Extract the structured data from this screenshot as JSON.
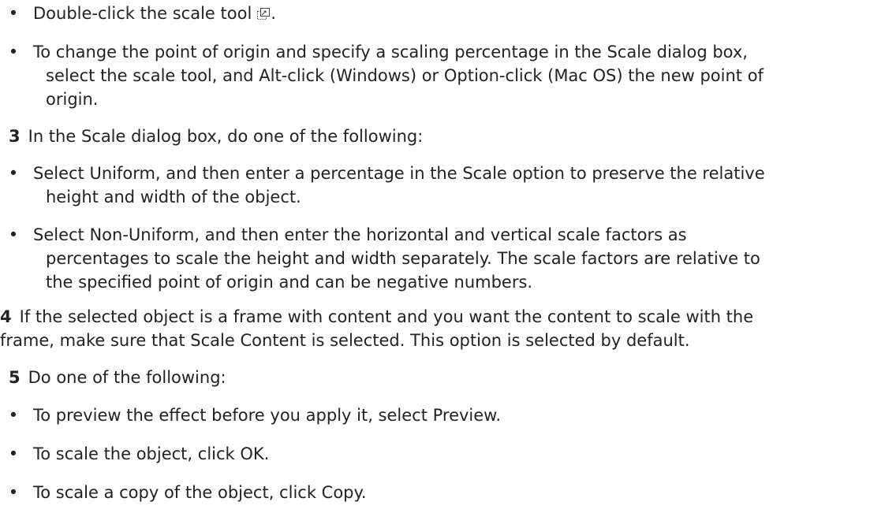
{
  "items": [
    {
      "kind": "bullet",
      "text": "Double-click the scale tool",
      "suffix": ".",
      "icon": "scale-tool-icon"
    },
    {
      "kind": "bullet",
      "lines": [
        "To change the point of origin and specify a scaling percentage in the Scale dialog box,",
        "select the scale tool, and Alt-click (Windows) or Option-click (Mac OS) the new point of",
        "origin."
      ]
    },
    {
      "kind": "step",
      "num": "3",
      "text": "In the Scale dialog box, do one of the following:"
    },
    {
      "kind": "bullet",
      "lines": [
        "Select Uniform, and then enter a percentage in the Scale option to preserve the relative",
        "height and width of the object."
      ]
    },
    {
      "kind": "bullet",
      "lines": [
        "Select Non-Uniform, and then enter the horizontal and vertical scale factors as",
        "percentages to scale the height and width separately. The scale factors are relative to",
        "the specified point of origin and can be negative numbers."
      ]
    },
    {
      "kind": "step-para",
      "num": "4",
      "lines": [
        "If the selected object is a frame with content and you want the content to scale with the",
        "frame, make sure that Scale Content is selected. This option is selected by default."
      ]
    },
    {
      "kind": "step",
      "num": "5",
      "text": "Do one of the following:"
    },
    {
      "kind": "bullet",
      "text": "To preview the effect before you apply it, select Preview."
    },
    {
      "kind": "bullet",
      "text": "To scale the object, click OK."
    },
    {
      "kind": "bullet",
      "text": "To scale a copy of the object, click Copy."
    }
  ],
  "bullet_char": "•",
  "colors": {
    "text": "#222222",
    "background": "#ffffff"
  }
}
